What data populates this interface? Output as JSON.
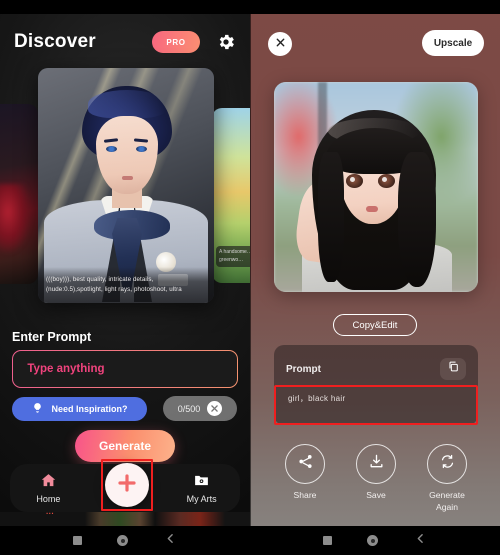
{
  "app": {
    "left_screen_title": "Discover",
    "pro_badge": "PRO",
    "gear_icon": "gear-icon"
  },
  "carousel": {
    "main_card_caption": "(((boy))), best quality, intricate details, (nude:0.5),spotlight, light rays, photoshoot, ultra",
    "right_card_caption": "A handsome… greenwo…"
  },
  "prompt_section": {
    "label": "Enter Prompt",
    "placeholder": "Type anything",
    "value": "",
    "inspiration_button": "Need Inspiration?",
    "inspiration_icon": "lightbulb-icon",
    "counter": "0/500",
    "clear_icon": "close-icon",
    "generate_button": "Generate"
  },
  "bottom_nav": {
    "items": [
      {
        "label": "Home",
        "icon": "home-icon"
      },
      {
        "label": "My Arts",
        "icon": "folder-photo-icon"
      }
    ],
    "fab_icon": "plus-icon"
  },
  "result_screen": {
    "close_icon": "close-icon",
    "upscale_button": "Upscale",
    "copy_edit_button": "Copy&Edit",
    "prompt_card": {
      "title": "Prompt",
      "copy_icon": "copy-icon",
      "text": "girl，black hair"
    },
    "actions": [
      {
        "label": "Share",
        "icon": "share-icon"
      },
      {
        "label": "Save",
        "icon": "download-icon"
      },
      {
        "label": "Generate\nAgain",
        "icon": "refresh-icon",
        "line1": "Generate",
        "line2": "Again"
      }
    ]
  },
  "system_nav": {
    "recents_icon": "square-icon",
    "home_icon": "circle-icon",
    "back_icon": "chevron-left-icon"
  },
  "colors": {
    "accent_pink": "#f0437d",
    "accent_gradient_start": "#f8538a",
    "accent_gradient_end": "#fcb28b",
    "inspire_blue": "#4f6ee0",
    "result_bg": "#7d4a45",
    "annotation_red": "#ef1f1f"
  }
}
